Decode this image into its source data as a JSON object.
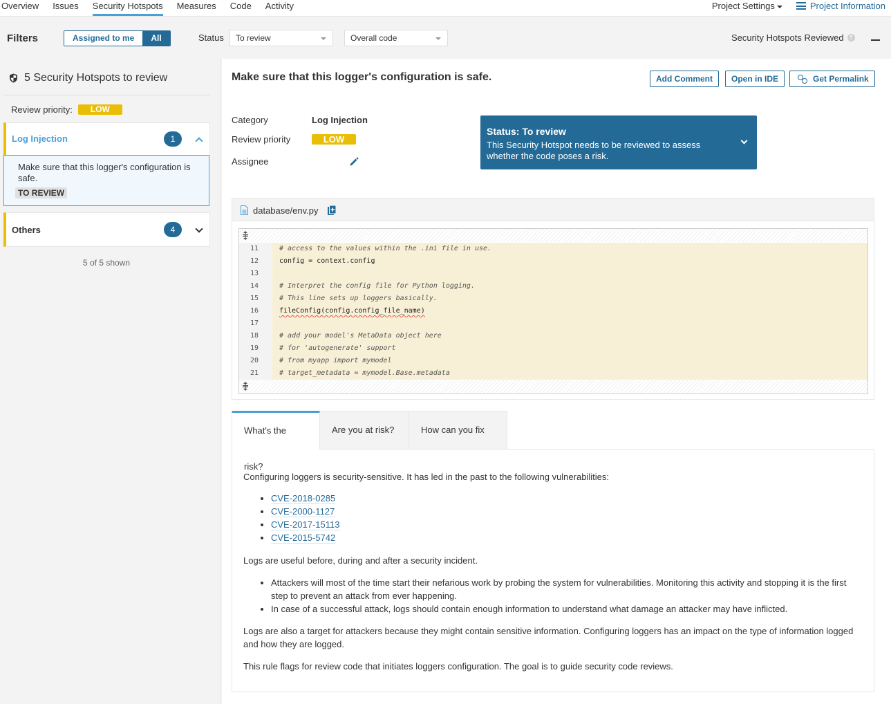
{
  "nav": {
    "tabs": [
      {
        "label": "Overview",
        "active": false
      },
      {
        "label": "Issues",
        "active": false
      },
      {
        "label": "Security Hotspots",
        "active": true
      },
      {
        "label": "Measures",
        "active": false
      },
      {
        "label": "Code",
        "active": false
      },
      {
        "label": "Activity",
        "active": false
      }
    ],
    "project_settings": "Project Settings",
    "project_information": "Project Information"
  },
  "filters": {
    "title": "Filters",
    "assigned_to_me": "Assigned to me",
    "all": "All",
    "status_label": "Status",
    "status_value": "To review",
    "scope_value": "Overall code",
    "reviewed_label": "Security Hotspots Reviewed",
    "reviewed_value": "—"
  },
  "sidebar": {
    "heading": "5 Security Hotspots to review",
    "review_priority_label": "Review priority:",
    "review_priority_value": "LOW",
    "categories": [
      {
        "name": "Log Injection",
        "count": "1",
        "expanded": true
      },
      {
        "name": "Others",
        "count": "4",
        "expanded": false
      }
    ],
    "selected_hotspot": {
      "message": "Make sure that this logger's configuration is safe.",
      "status": "TO REVIEW"
    },
    "shown": "5 of 5 shown"
  },
  "hotspot": {
    "title": "Make sure that this logger's configuration is safe.",
    "buttons": {
      "add_comment": "Add Comment",
      "open_in_ide": "Open in IDE",
      "get_permalink": "Get Permalink"
    },
    "category_label": "Category",
    "category_value": "Log Injection",
    "priority_label": "Review priority",
    "priority_value": "LOW",
    "assignee_label": "Assignee",
    "status_box": {
      "heading": "Status: To review",
      "description": "This Security Hotspot needs to be reviewed to assess whether the code poses a risk."
    }
  },
  "code": {
    "file": "database/env.py",
    "lines": [
      {
        "n": "11",
        "text": "# access to the values within the .ini file in use.",
        "comment": true
      },
      {
        "n": "12",
        "text": "config = context.config",
        "comment": false
      },
      {
        "n": "13",
        "text": "",
        "comment": false
      },
      {
        "n": "14",
        "text": "# Interpret the config file for Python logging.",
        "comment": true
      },
      {
        "n": "15",
        "text": "# This line sets up loggers basically.",
        "comment": true
      },
      {
        "n": "16",
        "text": "fileConfig(config.config_file_name)",
        "comment": false,
        "highlight": true
      },
      {
        "n": "17",
        "text": "",
        "comment": false
      },
      {
        "n": "18",
        "text": "# add your model's MetaData object here",
        "comment": true
      },
      {
        "n": "19",
        "text": "# for 'autogenerate' support",
        "comment": true
      },
      {
        "n": "20",
        "text": "# from myapp import mymodel",
        "comment": true
      },
      {
        "n": "21",
        "text": "# target_metadata = mymodel.Base.metadata",
        "comment": true
      }
    ]
  },
  "risk_tabs": [
    {
      "label": "What's the risk?",
      "active": true
    },
    {
      "label": "Are you at risk?",
      "active": false
    },
    {
      "label": "How can you fix it?",
      "active": false
    }
  ],
  "description": {
    "intro": "Configuring loggers is security-sensitive. It has led in the past to the following vulnerabilities:",
    "cves": [
      "CVE-2018-0285",
      "CVE-2000-1127",
      "CVE-2017-15113",
      "CVE-2015-5742"
    ],
    "logs_useful": "Logs are useful before, during and after a security incident.",
    "bullets": [
      "Attackers will most of the time start their nefarious work by probing the system for vulnerabilities. Monitoring this activity and stopping it is the first step to prevent an attack from ever happening.",
      "In case of a successful attack, logs should contain enough information to understand what damage an attacker may have inflicted."
    ],
    "logs_target": "Logs are also a target for attackers because they might contain sensitive information. Configuring loggers has an impact on the type of information logged and how they are logged.",
    "rule_flags": "This rule flags for review code that initiates loggers configuration. The goal is to guide security code reviews."
  },
  "colors": {
    "accent": "#236a97",
    "highlight_blue": "#4b9fd5",
    "priority_low": "#eabe06",
    "code_bg": "#f8f0d6"
  }
}
